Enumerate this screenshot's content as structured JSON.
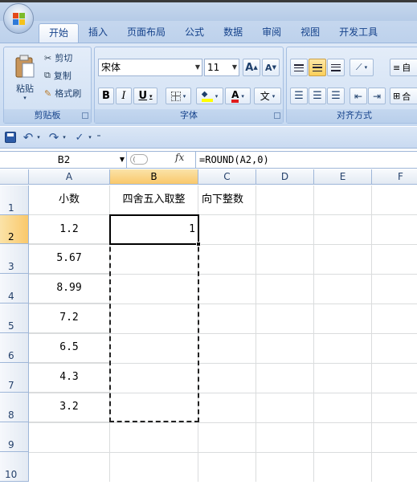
{
  "ribbon": {
    "tabs": [
      "开始",
      "插入",
      "页面布局",
      "公式",
      "数据",
      "审阅",
      "视图",
      "开发工具"
    ],
    "active_tab": "开始",
    "clipboard": {
      "paste": "粘贴",
      "cut": "剪切",
      "copy": "复制",
      "format_painter": "格式刷",
      "caption": "剪贴板"
    },
    "font": {
      "name": "宋体",
      "size": "11",
      "caption": "字体",
      "bold": "B",
      "italic": "I",
      "underline": "U",
      "grow": "A",
      "shrink": "A",
      "wen": "文"
    },
    "align": {
      "caption": "对齐方式",
      "wrap": "自",
      "merge": "合"
    }
  },
  "formula_bar": {
    "name_box": "B2",
    "fx": "fx",
    "formula": "=ROUND(A2,0)"
  },
  "columns": [
    "A",
    "B",
    "C",
    "D",
    "E",
    "F"
  ],
  "rows": [
    "1",
    "2",
    "3",
    "4",
    "5",
    "6",
    "7",
    "8",
    "9",
    "10"
  ],
  "cells": {
    "A1": "小数",
    "B1": "四舍五入取整",
    "C1": "向下整数",
    "A2": "1.2",
    "B2": "1",
    "A3": "5.67",
    "A4": "8.99",
    "A5": "7.2",
    "A6": "6.5",
    "A7": "4.3",
    "A8": "3.2"
  },
  "colors": {
    "selection_border": "#000000",
    "header_selected": "#f9c86b",
    "ribbon_bg": "#d2e1f4"
  }
}
